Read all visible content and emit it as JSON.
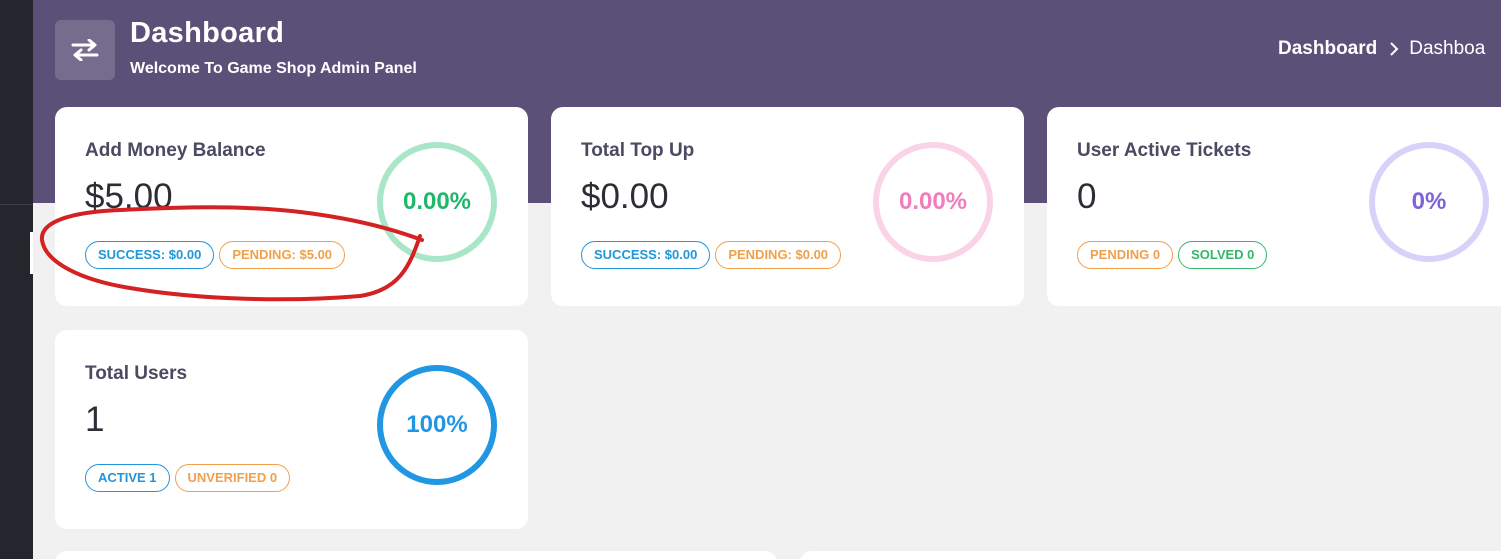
{
  "header": {
    "title": "Dashboard",
    "subtitle": "Welcome To Game Shop Admin Panel",
    "icon": "swap-arrows-icon"
  },
  "breadcrumb": {
    "home": "Dashboard",
    "current": "Dashboa"
  },
  "colors": {
    "header_bg": "#5b5178",
    "page_bg": "#f1f1f1",
    "sidebar_bg": "#23262c",
    "annotation": "#d42121"
  },
  "cards": [
    {
      "title": "Add Money Balance",
      "value": "$5.00",
      "badges": [
        "SUCCESS: $0.00",
        "PENDING: $5.00"
      ],
      "ring_label": "0.00%",
      "ring_fill": 0.0,
      "ring_color": "#a8e6c7",
      "ring_text_color": "#1fb86a"
    },
    {
      "title": "Total Top Up",
      "value": "$0.00",
      "badges": [
        "SUCCESS: $0.00",
        "PENDING: $0.00"
      ],
      "ring_label": "0.00%",
      "ring_fill": 0.0,
      "ring_color": "#fbd3e6",
      "ring_text_color": "#f07dbd"
    },
    {
      "title": "User Active Tickets",
      "value": "0",
      "badges": [
        "PENDING 0",
        "SOLVED 0"
      ],
      "ring_label": "0%",
      "ring_fill": 0.0,
      "ring_color": "#d9d1f9",
      "ring_text_color": "#7b63d8"
    },
    {
      "title": "Total Users",
      "value": "1",
      "badges": [
        "ACTIVE 1",
        "UNVERIFIED 0"
      ],
      "ring_label": "100%",
      "ring_fill": 1.0,
      "ring_color": "#2196e3",
      "ring_text_color": "#2196e3"
    }
  ]
}
